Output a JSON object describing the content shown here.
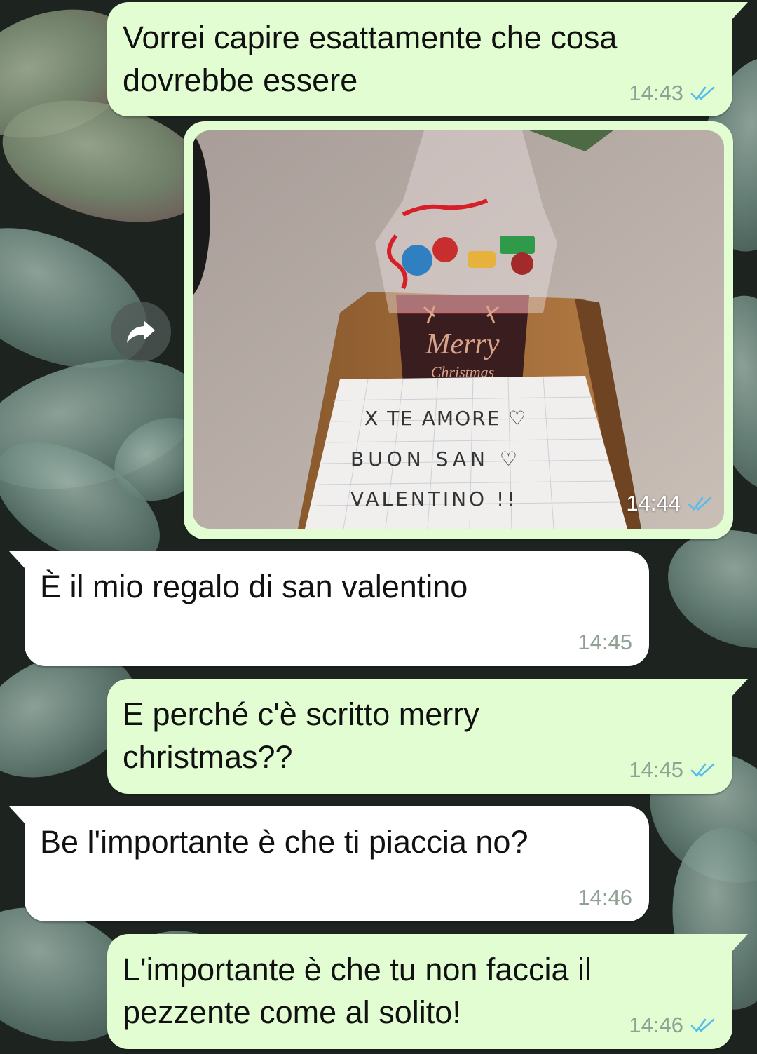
{
  "colors": {
    "outgoing_bubble": "#e1fdd1",
    "incoming_bubble": "#ffffff",
    "read_tick": "#53bdeb",
    "timestamp": "#8fa095"
  },
  "icons": {
    "forward": "forward-icon",
    "read_receipt": "double-check-icon"
  },
  "messages": [
    {
      "direction": "outgoing",
      "text": "Vorrei capire esattamente che cosa\ndovrebbe essere",
      "time": "14:43",
      "status": "read"
    },
    {
      "direction": "outgoing",
      "type": "image",
      "time": "14:44",
      "status": "read",
      "image": {
        "label": "Merry\nChristmas",
        "note": "X TE AMORE ♡\nBUON SAN ♡\nVALENTINO !!"
      }
    },
    {
      "direction": "incoming",
      "text": "È il mio regalo di san valentino",
      "time": "14:45"
    },
    {
      "direction": "outgoing",
      "text": "E perché c'è scritto merry\nchristmas??",
      "time": "14:45",
      "status": "read"
    },
    {
      "direction": "incoming",
      "text": "Be l'importante è che ti piaccia no?",
      "time": "14:46"
    },
    {
      "direction": "outgoing",
      "text": "L'importante è che tu non faccia il\npezzente come al solito!",
      "time": "14:46",
      "status": "read"
    }
  ]
}
